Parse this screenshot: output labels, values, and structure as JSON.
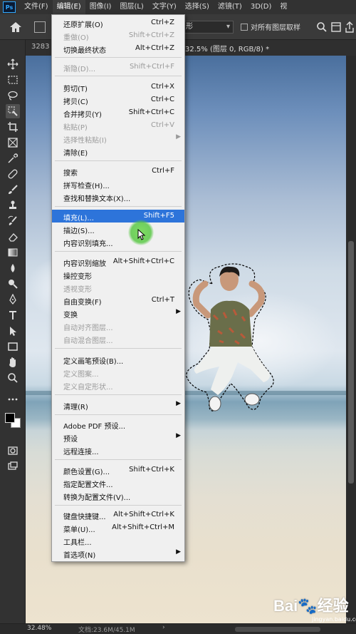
{
  "menubar": {
    "logo": "Ps",
    "items": [
      "文件(F)",
      "编辑(E)",
      "图像(I)",
      "图层(L)",
      "文字(Y)",
      "选择(S)",
      "滤镜(T)",
      "3D(D)",
      "视"
    ]
  },
  "options": {
    "sample_value": "形",
    "all_layers_label": "对所有图层取样"
  },
  "tabs": {
    "left": "3283",
    "right": "32.5% (图层 0, RGB/8) *",
    "close": "×"
  },
  "edit_menu": {
    "items": [
      {
        "label": "还原扩展(O)",
        "shortcut": "Ctrl+Z",
        "state": "enabled"
      },
      {
        "label": "重做(O)",
        "shortcut": "Shift+Ctrl+Z",
        "state": "disabled"
      },
      {
        "label": "切换最终状态",
        "shortcut": "Alt+Ctrl+Z",
        "state": "enabled"
      },
      {
        "label": "渐隐(D)...",
        "shortcut": "Shift+Ctrl+F",
        "state": "disabled"
      },
      {
        "label": "剪切(T)",
        "shortcut": "Ctrl+X",
        "state": "enabled"
      },
      {
        "label": "拷贝(C)",
        "shortcut": "Ctrl+C",
        "state": "enabled"
      },
      {
        "label": "合并拷贝(Y)",
        "shortcut": "Shift+Ctrl+C",
        "state": "enabled"
      },
      {
        "label": "粘贴(P)",
        "shortcut": "Ctrl+V",
        "state": "disabled"
      },
      {
        "label": "选择性粘贴(I)",
        "shortcut": "",
        "state": "disabled",
        "submenu": true
      },
      {
        "label": "清除(E)",
        "shortcut": "",
        "state": "enabled"
      },
      {
        "label": "搜索",
        "shortcut": "Ctrl+F",
        "state": "enabled"
      },
      {
        "label": "拼写检查(H)...",
        "shortcut": "",
        "state": "enabled"
      },
      {
        "label": "查找和替换文本(X)...",
        "shortcut": "",
        "state": "enabled"
      },
      {
        "label": "填充(L)...",
        "shortcut": "Shift+F5",
        "state": "highlighted"
      },
      {
        "label": "描边(S)...",
        "shortcut": "",
        "state": "enabled"
      },
      {
        "label": "内容识别填充...",
        "shortcut": "",
        "state": "enabled"
      },
      {
        "label": "内容识别缩放",
        "shortcut": "Alt+Shift+Ctrl+C",
        "state": "enabled"
      },
      {
        "label": "操控变形",
        "shortcut": "",
        "state": "enabled"
      },
      {
        "label": "透视变形",
        "shortcut": "",
        "state": "disabled"
      },
      {
        "label": "自由变换(F)",
        "shortcut": "Ctrl+T",
        "state": "enabled"
      },
      {
        "label": "变换",
        "shortcut": "",
        "state": "enabled",
        "submenu": true
      },
      {
        "label": "自动对齐图层...",
        "shortcut": "",
        "state": "disabled"
      },
      {
        "label": "自动混合图层...",
        "shortcut": "",
        "state": "disabled"
      },
      {
        "label": "定义画笔预设(B)...",
        "shortcut": "",
        "state": "enabled"
      },
      {
        "label": "定义图案...",
        "shortcut": "",
        "state": "disabled"
      },
      {
        "label": "定义自定形状...",
        "shortcut": "",
        "state": "disabled"
      },
      {
        "label": "清理(R)",
        "shortcut": "",
        "state": "enabled",
        "submenu": true
      },
      {
        "label": "Adobe PDF 预设...",
        "shortcut": "",
        "state": "enabled"
      },
      {
        "label": "预设",
        "shortcut": "",
        "state": "enabled",
        "submenu": true
      },
      {
        "label": "远程连接...",
        "shortcut": "",
        "state": "enabled"
      },
      {
        "label": "颜色设置(G)...",
        "shortcut": "Shift+Ctrl+K",
        "state": "enabled"
      },
      {
        "label": "指定配置文件...",
        "shortcut": "",
        "state": "enabled"
      },
      {
        "label": "转换为配置文件(V)...",
        "shortcut": "",
        "state": "enabled"
      },
      {
        "label": "键盘快捷键...",
        "shortcut": "Alt+Shift+Ctrl+K",
        "state": "enabled"
      },
      {
        "label": "菜单(U)...",
        "shortcut": "Alt+Shift+Ctrl+M",
        "state": "enabled"
      },
      {
        "label": "工具栏...",
        "shortcut": "",
        "state": "enabled"
      },
      {
        "label": "首选项(N)",
        "shortcut": "",
        "state": "enabled",
        "submenu": true
      }
    ]
  },
  "toolbar": {
    "tools": [
      "move-icon",
      "marquee-icon",
      "lasso-icon",
      "quick-select-icon",
      "crop-icon",
      "frame-icon",
      "eyedropper-icon",
      "healing-icon",
      "brush-icon",
      "stamp-icon",
      "history-brush-icon",
      "eraser-icon",
      "gradient-icon",
      "blur-icon",
      "dodge-icon",
      "pen-icon",
      "type-icon",
      "path-select-icon",
      "rectangle-icon",
      "hand-icon",
      "zoom-icon",
      "more-tools-icon"
    ],
    "selected_tool": "quick-select-icon"
  },
  "status": {
    "zoom": "32.48%",
    "doc_info": "文档:23.6M/45.1M",
    "arrow": "›"
  },
  "watermark": {
    "logo": "Bai🐾经验",
    "sub": "jingyan.baidu.com"
  },
  "colors": {
    "accent": "#2d74da",
    "cursor_highlight": "#6cd24c",
    "menu_bg": "#f0f0f0",
    "chrome": "#323232"
  }
}
